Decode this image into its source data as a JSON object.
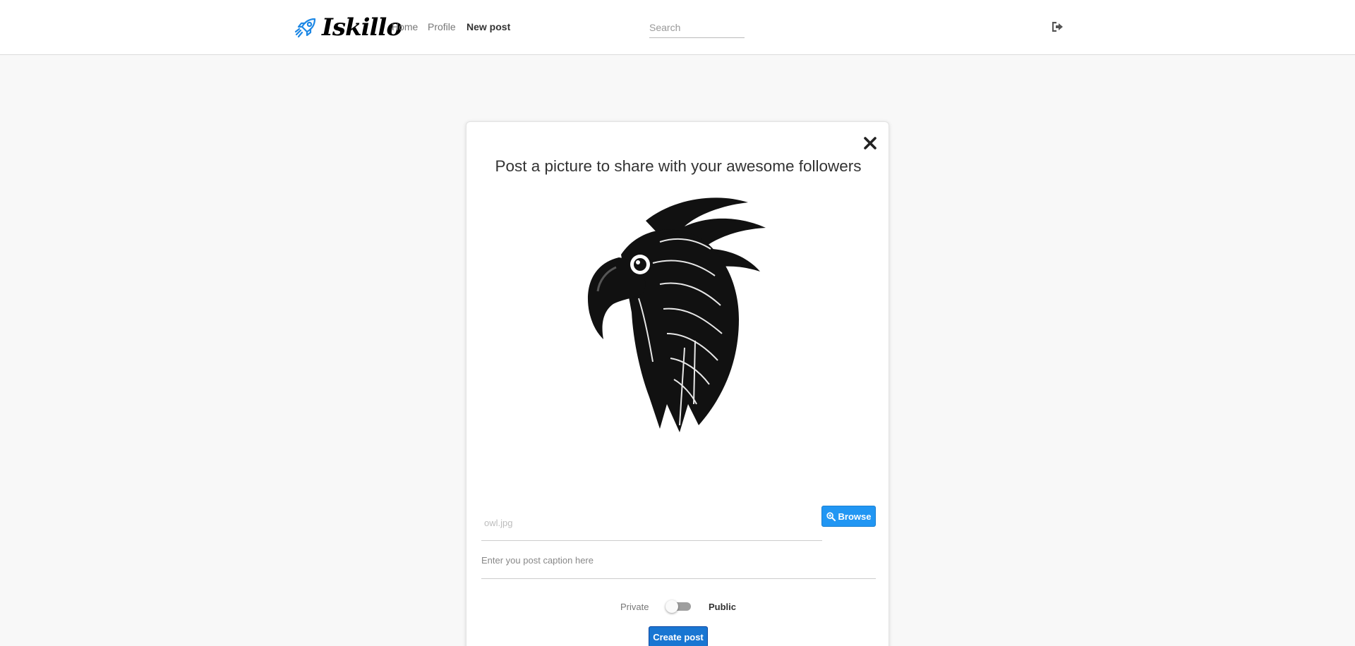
{
  "brand": {
    "name": "Iskillo",
    "icon": "rocket-icon",
    "icon_color": "#2196f3"
  },
  "nav": {
    "home": "Home",
    "profile": "Profile",
    "new_post": "New post"
  },
  "search": {
    "placeholder": "Search",
    "value": ""
  },
  "header": {
    "signout_icon": "sign-out-icon"
  },
  "modal": {
    "title": "Post a picture to share with your awesome followers",
    "close_icon": "close-icon",
    "image_alt": "parrot drawing",
    "file_placeholder": "owl.jpg",
    "browse_label": "Browse",
    "browse_icon": "search-plus-icon",
    "caption_placeholder": "Enter you post caption here",
    "private_label": "Private",
    "public_label": "Public",
    "is_public": false,
    "submit_label": "Create post"
  },
  "colors": {
    "accent": "#2196f3",
    "submit": "#1976d2",
    "background": "#f8f8f8"
  }
}
